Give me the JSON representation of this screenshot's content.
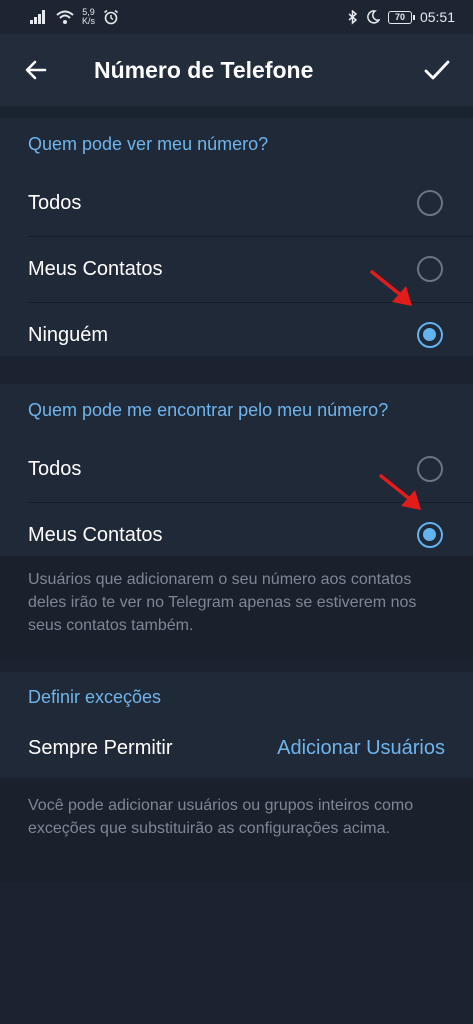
{
  "status_bar": {
    "speed_value": "5,9",
    "speed_unit": "K/s",
    "battery": "70",
    "time": "05:51"
  },
  "header": {
    "title": "Número de Telefone",
    "back_icon": "arrow-left-icon",
    "confirm_icon": "check-icon"
  },
  "who_can_see": {
    "title": "Quem pode ver meu número?",
    "options": [
      {
        "label": "Todos",
        "selected": false
      },
      {
        "label": "Meus Contatos",
        "selected": false
      },
      {
        "label": "Ninguém",
        "selected": true
      }
    ]
  },
  "who_can_find": {
    "title": "Quem pode me encontrar pelo meu número?",
    "options": [
      {
        "label": "Todos",
        "selected": false
      },
      {
        "label": "Meus Contatos",
        "selected": true
      }
    ],
    "info": "Usuários que adicionarem o seu número aos contatos deles irão te ver no Telegram apenas se estiverem nos seus contatos também."
  },
  "exceptions": {
    "title": "Definir exceções",
    "always_allow_label": "Sempre Permitir",
    "add_users_label": "Adicionar Usuários",
    "info": "Você pode adicionar usuários ou grupos inteiros como exceções que substituirão as configurações acima."
  },
  "colors": {
    "accent": "#62b3f0",
    "annotation_arrow": "#e21b1b"
  }
}
